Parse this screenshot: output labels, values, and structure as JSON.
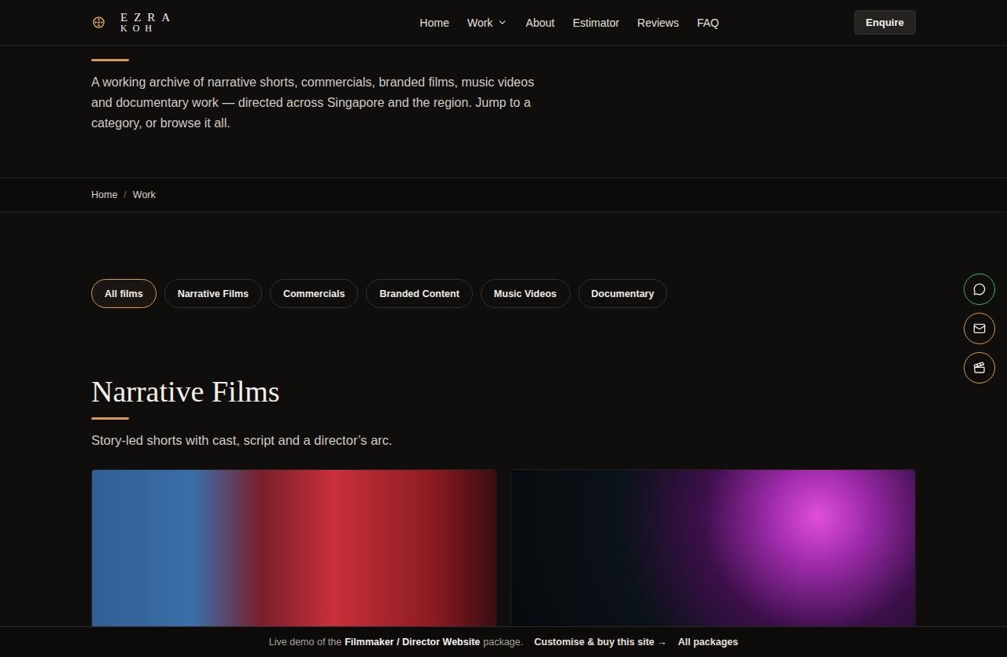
{
  "header": {
    "logo": {
      "line1": "EZRA",
      "line2": "KOH"
    },
    "nav": [
      {
        "label": "Home",
        "has_dropdown": false
      },
      {
        "label": "Work",
        "has_dropdown": true
      },
      {
        "label": "About",
        "has_dropdown": false
      },
      {
        "label": "Estimator",
        "has_dropdown": false
      },
      {
        "label": "Reviews",
        "has_dropdown": false
      },
      {
        "label": "FAQ",
        "has_dropdown": false
      }
    ],
    "cta": "Enquire"
  },
  "hero": {
    "description": "A working archive of narrative shorts, commercials, branded films, music videos and documentary work — directed across Singapore and the region. Jump to a category, or browse it all."
  },
  "breadcrumb": {
    "items": [
      "Home",
      "Work"
    ],
    "separator": "/"
  },
  "filters": [
    {
      "label": "All films",
      "selected": true
    },
    {
      "label": "Narrative Films",
      "selected": false
    },
    {
      "label": "Commercials",
      "selected": false
    },
    {
      "label": "Branded Content",
      "selected": false
    },
    {
      "label": "Music Videos",
      "selected": false
    },
    {
      "label": "Documentary",
      "selected": false
    }
  ],
  "section": {
    "title": "Narrative Films",
    "subtitle": "Story-led shorts with cast, script and a director’s arc.",
    "cards": [
      {
        "kind": "rain"
      },
      {
        "kind": "neon"
      }
    ]
  },
  "floating_actions": [
    {
      "kind": "chat",
      "color": "#3fb36b"
    },
    {
      "kind": "mail",
      "color": "#d99a52"
    },
    {
      "kind": "film",
      "color": "#d99a52"
    }
  ],
  "demo_bar": {
    "prefix": "Live demo of the",
    "package": "Filmmaker / Director Website",
    "suffix": "package.",
    "links": [
      "Customise & buy this site →",
      "All packages"
    ]
  }
}
